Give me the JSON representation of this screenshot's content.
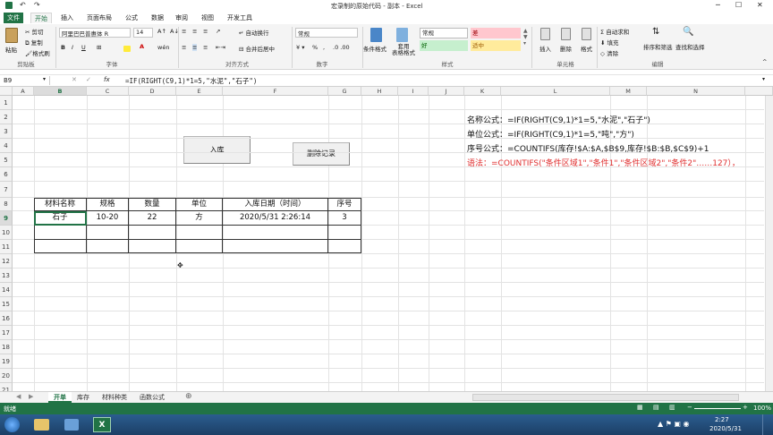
{
  "title": "宏录制的原始代码 - 副本 - Excel",
  "tabs": [
    "文件",
    "开始",
    "插入",
    "页面布局",
    "公式",
    "数据",
    "审阅",
    "视图",
    "开发工具"
  ],
  "ribbon": {
    "clipboard": {
      "paste": "粘贴",
      "cut": "剪切",
      "copy": "复制",
      "format_painter": "格式刷",
      "group": "剪贴板"
    },
    "font": {
      "name": "阿里巴巴普惠体 R",
      "size": "14",
      "group": "字体"
    },
    "alignment": {
      "wrap": "自动换行",
      "merge": "合并后居中",
      "group": "对齐方式"
    },
    "number": {
      "format": "常规",
      "group": "数字"
    },
    "styles": {
      "cond": "条件格式",
      "table": "套用\n表格格式",
      "normal": "常规",
      "bad": "差",
      "good": "好",
      "neutral": "适中",
      "group": "样式"
    },
    "cells": {
      "insert": "插入",
      "delete": "删除",
      "format": "格式",
      "group": "单元格"
    },
    "editing": {
      "autosum": "自动求和",
      "fill": "填充",
      "clear": "清除",
      "sort": "排序和筛选",
      "find": "查找和选择",
      "group": "编辑"
    }
  },
  "formula_bar": {
    "name_box": "B9",
    "formula": "=IF(RIGHT(C9,1)*1=5,\"水泥\",\"石子\")"
  },
  "columns": [
    "A",
    "B",
    "C",
    "D",
    "E",
    "F",
    "G",
    "H",
    "I",
    "J",
    "K",
    "L",
    "M",
    "N"
  ],
  "rows": [
    "1",
    "2",
    "3",
    "4",
    "5",
    "6",
    "7",
    "8",
    "9",
    "10",
    "11",
    "12",
    "13",
    "14",
    "15",
    "16",
    "17",
    "18",
    "19",
    "20",
    "21"
  ],
  "buttons": {
    "in_stock": "入库",
    "delete_record": "删除记录"
  },
  "table": {
    "headers": [
      "材料名称",
      "规格",
      "数量",
      "单位",
      "入库日期（时间）",
      "序号"
    ],
    "rows": [
      [
        "石子",
        "10-20",
        "22",
        "方",
        "2020/5/31 2:26:14",
        "3"
      ],
      [
        "",
        "",
        "",
        "",
        "",
        ""
      ],
      [
        "",
        "",
        "",
        "",
        "",
        ""
      ]
    ]
  },
  "notes": {
    "line1": "名称公式：=IF(RIGHT(C9,1)*1=5,\"水泥\",\"石子\")",
    "line2": "单位公式：=IF(RIGHT(C9,1)*1=5,\"吨\",\"方\")",
    "line3": "序号公式：=COUNTIFS(库存!$A:$A,$B$9,库存!$B:$B,$C$9)+1",
    "line4": "语法：=COUNTIFS(\"条件区域1\",\"条件1\",\"条件区域2\",\"条件2\"……127），",
    "line4_color": "#e03030"
  },
  "sheet_tabs": [
    "开单",
    "库存",
    "材料种类",
    "函数公式"
  ],
  "status": {
    "ready": "就绪",
    "zoom": "100%"
  },
  "taskbar": {
    "time": "2:27",
    "date": "2020/5/31"
  }
}
